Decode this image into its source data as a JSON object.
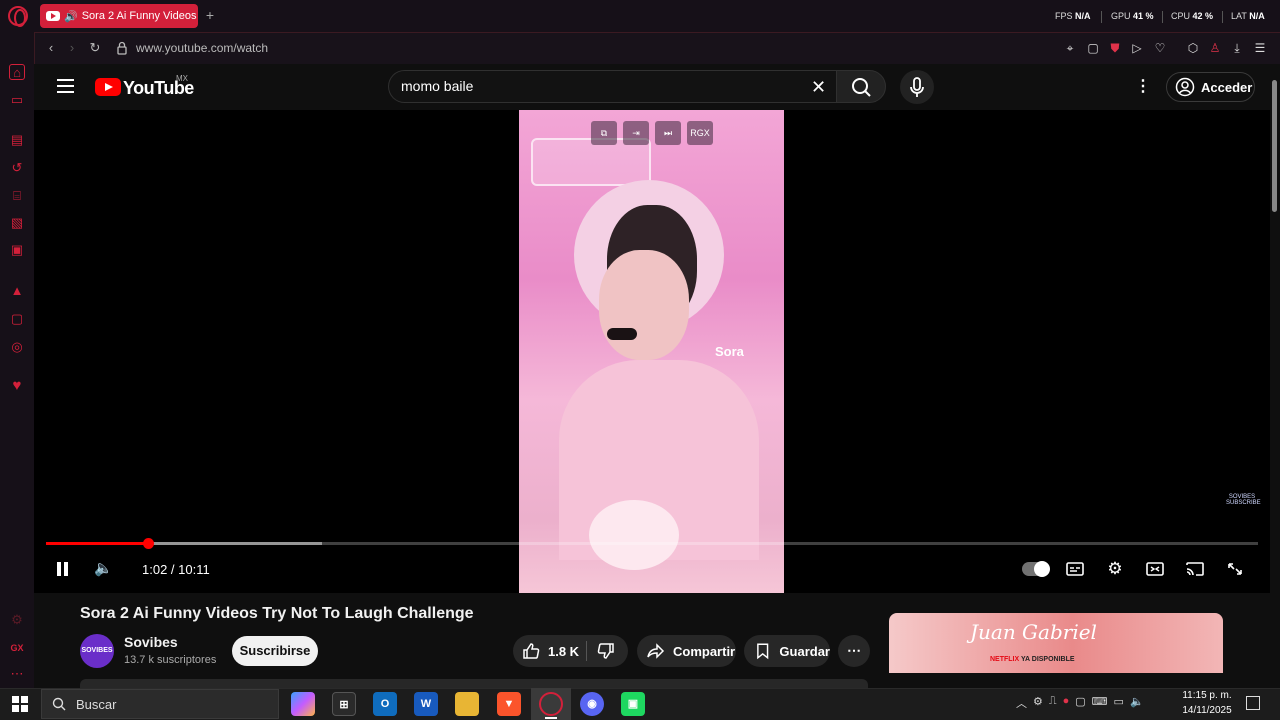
{
  "browser": {
    "tab_title": "Sora 2 Ai Funny Videos",
    "new_tab": "+",
    "url": "www.youtube.com/watch",
    "stats": {
      "fps_label": "FPS",
      "fps_value": "N/A",
      "gpu_label": "GPU",
      "gpu_value": "41 %",
      "cpu_label": "CPU",
      "cpu_value": "42 %",
      "lat_label": "LAT",
      "lat_value": "N/A"
    }
  },
  "youtube": {
    "wordmark": "YouTube",
    "country": "MX",
    "search_value": "momo baile",
    "signin_label": "Acceder"
  },
  "player": {
    "overlay_buttons": [
      "⧉",
      "⇥",
      "⏭",
      "RGX"
    ],
    "sora_tag": "Sora",
    "watermark": "SOVIBES SUBSCRIBE",
    "time": "1:02 / 10:11",
    "progress_played_fraction": 0.084,
    "progress_buffered_fraction": 0.228
  },
  "video": {
    "title": "Sora 2 Ai Funny Videos Try Not To Laugh Challenge",
    "channel_avatar_text": "SOVIBES",
    "channel_name": "Sovibes",
    "channel_subs": "13.7 k suscriptores",
    "subscribe_label": "Suscribirse",
    "like_count": "1.8 K",
    "share_label": "Compartir",
    "save_label": "Guardar"
  },
  "ad": {
    "title": "Juan Gabriel",
    "netflix": "NETFLIX",
    "netflix_tag": "YA DISPONIBLE"
  },
  "taskbar": {
    "search_placeholder": "Buscar",
    "time": "11:15 p. m.",
    "date": "14/11/2025"
  },
  "colors": {
    "accent": "#d3203a",
    "youtube_red": "#ff0000",
    "background": "#0f0f0f"
  }
}
